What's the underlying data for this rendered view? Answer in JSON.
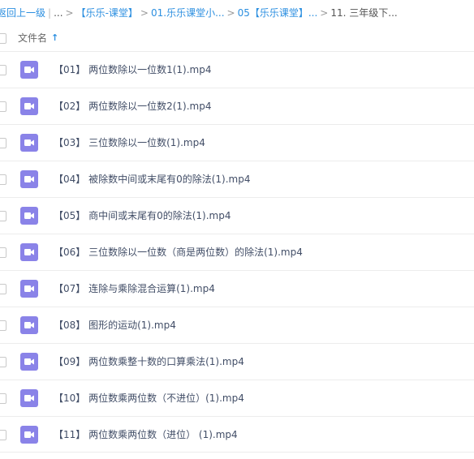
{
  "breadcrumb": {
    "back": "返回上一级",
    "bar": "|",
    "ellipsis": "...",
    "sep": ">",
    "items": [
      "【乐乐-课堂】",
      "01.乐乐课堂小...",
      "05【乐乐课堂】...",
      "11. 三年级下..."
    ]
  },
  "header": {
    "column_label": "文件名",
    "sort_arrow": "↑"
  },
  "files": [
    {
      "name": "【01】 两位数除以一位数1(1).mp4"
    },
    {
      "name": "【02】 两位数除以一位数2(1).mp4"
    },
    {
      "name": "【03】 三位数除以一位数(1).mp4"
    },
    {
      "name": "【04】 被除数中间或末尾有0的除法(1).mp4"
    },
    {
      "name": "【05】 商中间或末尾有0的除法(1).mp4"
    },
    {
      "name": "【06】 三位数除以一位数（商是两位数）的除法(1).mp4"
    },
    {
      "name": "【07】 连除与乘除混合运算(1).mp4"
    },
    {
      "name": "【08】 图形的运动(1).mp4"
    },
    {
      "name": "【09】 两位数乘整十数的口算乘法(1).mp4"
    },
    {
      "name": "【10】 两位数乘两位数（不进位）(1).mp4"
    },
    {
      "name": "【11】 两位数乘两位数（进位） (1).mp4"
    }
  ],
  "colors": {
    "link": "#2c8fe0",
    "video_icon_bg": "#8a83e8",
    "file_text": "#424e67"
  },
  "icons": {
    "file": "video-file-icon",
    "sort": "sort-ascending-icon"
  }
}
